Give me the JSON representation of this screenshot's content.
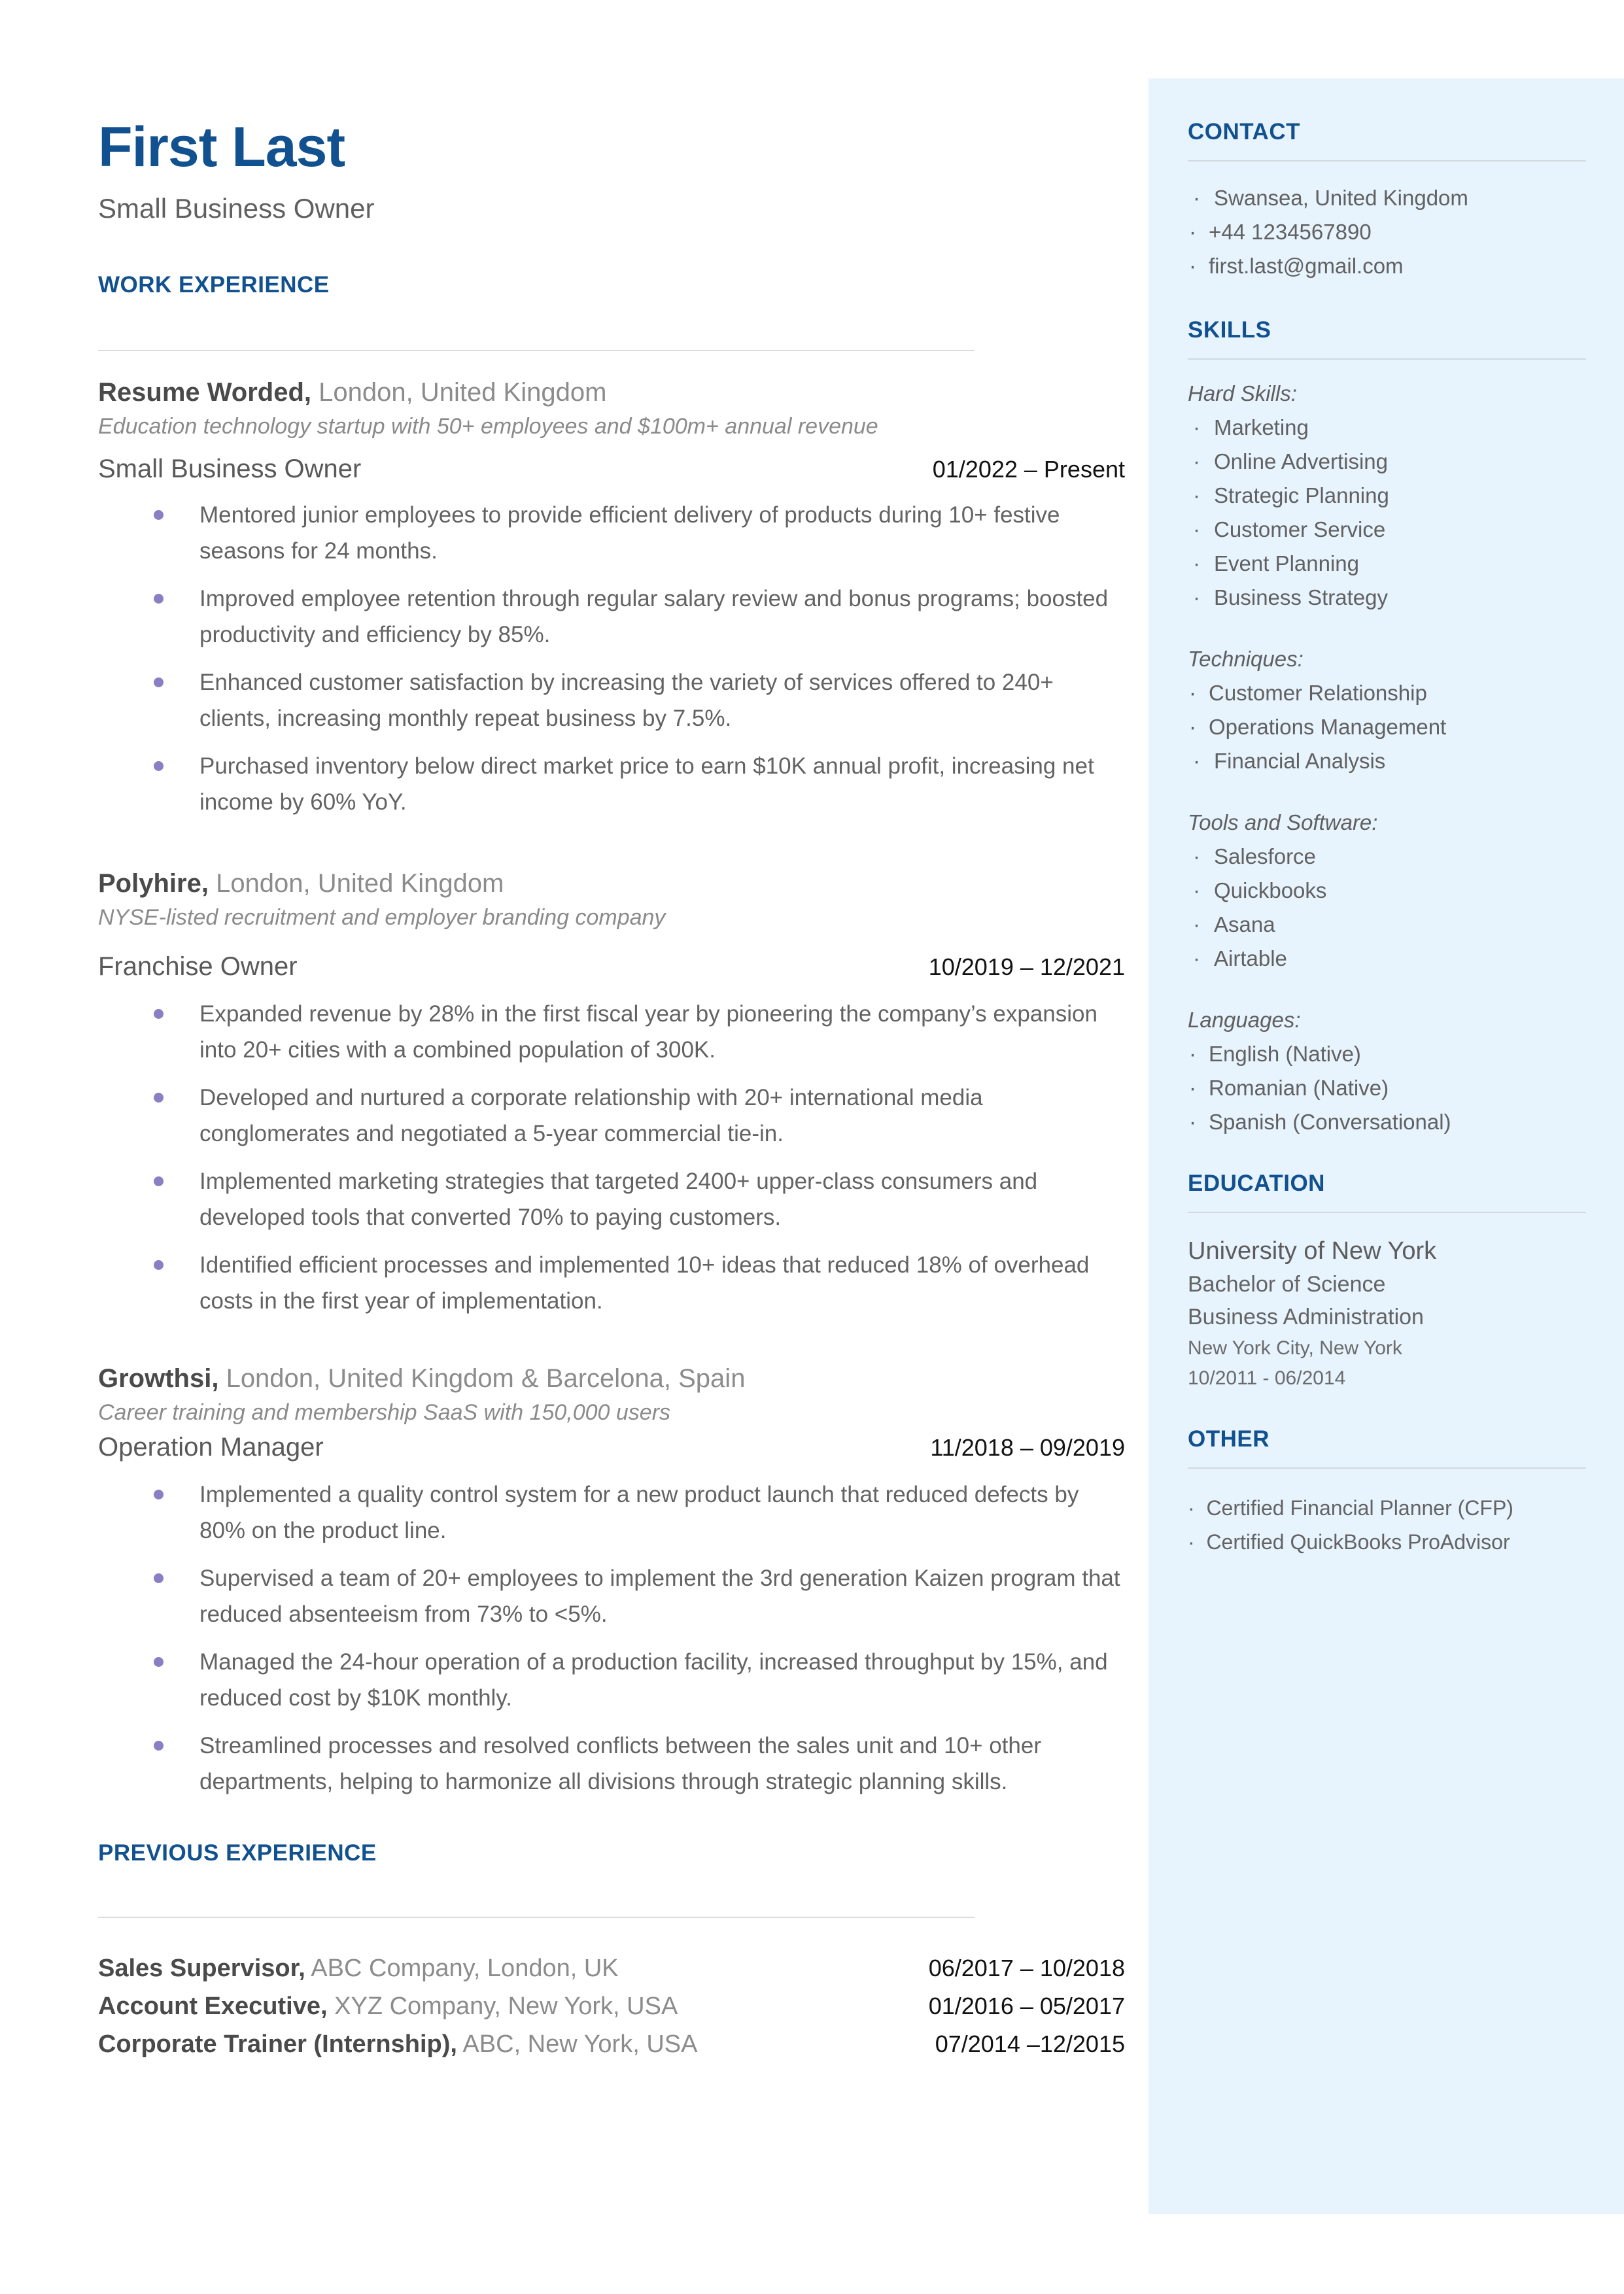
{
  "header": {
    "name": "First Last",
    "subtitle": "Small Business Owner"
  },
  "sections": {
    "work_experience": "WORK EXPERIENCE",
    "previous_experience": "PREVIOUS EXPERIENCE",
    "contact": "CONTACT",
    "skills": "SKILLS",
    "education": "EDUCATION",
    "other": "OTHER"
  },
  "jobs": [
    {
      "company": "Resume Worded,",
      "location": " London, United Kingdom",
      "description": "Education technology startup with 50+ employees and $100m+ annual revenue",
      "title": "Small Business Owner",
      "dates": "01/2022 – Present",
      "bullets": [
        "Mentored junior employees to provide efficient delivery of products during 10+ festive seasons for 24 months.",
        "Improved employee retention through regular salary review and bonus programs; boosted productivity and efficiency by 85%.",
        "Enhanced customer satisfaction by increasing the variety of services offered to 240+ clients, increasing monthly repeat business by 7.5%.",
        "Purchased inventory below direct market price to earn $10K annual profit, increasing net income by 60% YoY."
      ]
    },
    {
      "company": "Polyhire,",
      "location": " London, United Kingdom",
      "description": "NYSE-listed recruitment and employer branding company",
      "title": "Franchise Owner",
      "dates": "10/2019 – 12/2021",
      "bullets": [
        "Expanded revenue by 28% in the first fiscal year by pioneering the company’s expansion into 20+ cities with a combined population of 300K.",
        "Developed and nurtured a corporate relationship with 20+ international media conglomerates and negotiated a 5-year commercial tie-in.",
        "Implemented marketing strategies that targeted 2400+ upper-class consumers and developed tools that converted 70% to paying customers.",
        "Identified efficient processes and implemented 10+ ideas that reduced 18% of overhead costs in the first year of implementation."
      ]
    },
    {
      "company": "Growthsi,",
      "location": " London, United Kingdom & Barcelona, Spain",
      "description": "Career training and membership SaaS with 150,000 users",
      "title": "Operation Manager",
      "dates": "11/2018 – 09/2019",
      "bullets": [
        "Implemented a quality control system for a new product launch that reduced defects by 80% on the product line.",
        "Supervised a team of 20+ employees to implement the 3rd generation Kaizen program that reduced absenteeism from 73% to <5%.",
        "Managed the 24-hour operation of a production facility, increased throughput by 15%, and reduced cost by $10K monthly.",
        "Streamlined processes and resolved conflicts between the sales unit and 10+ other departments, helping to harmonize all divisions through strategic planning skills."
      ]
    }
  ],
  "previous_experience": [
    {
      "role": "Sales Supervisor,",
      "detail": " ABC Company, London, UK",
      "dates": "06/2017 – 10/2018"
    },
    {
      "role": "Account Executive,",
      "detail": " XYZ Company, New York, USA",
      "dates": "01/2016 – 05/2017"
    },
    {
      "role": "Corporate Trainer (Internship),",
      "detail": " ABC, New York, USA",
      "dates": "07/2014 –12/2015"
    }
  ],
  "contact": {
    "items": [
      "Swansea, United Kingdom",
      "+44 1234567890",
      "first.last@gmail.com"
    ]
  },
  "skills": {
    "groups": [
      {
        "label": "Hard Skills:",
        "items": [
          "Marketing",
          "Online Advertising",
          "Strategic Planning",
          "Customer Service",
          "Event Planning",
          "Business Strategy"
        ]
      },
      {
        "label": "Techniques:",
        "items": [
          "Customer Relationship",
          "Operations Management",
          "Financial Analysis"
        ]
      },
      {
        "label": "Tools and Software:",
        "items": [
          "Salesforce",
          "Quickbooks",
          "Asana",
          "Airtable"
        ]
      },
      {
        "label": "Languages:",
        "items": [
          "English (Native)",
          "Romanian (Native)",
          "Spanish (Conversational)"
        ]
      }
    ]
  },
  "education": {
    "school": "University of New York",
    "degree": "Bachelor of Science",
    "field": "Business Administration",
    "location": "New York City, New York",
    "dates": "10/2011 - 06/2014"
  },
  "other": {
    "items": [
      "Certified Financial Planner (CFP)",
      "Certified QuickBooks ProAdvisor"
    ]
  },
  "colors": {
    "accent_blue": "#11518f",
    "sidebar_bg": "#e7f3fd",
    "bullet_purple": "#8b7fc4",
    "body_gray": "#636363"
  }
}
